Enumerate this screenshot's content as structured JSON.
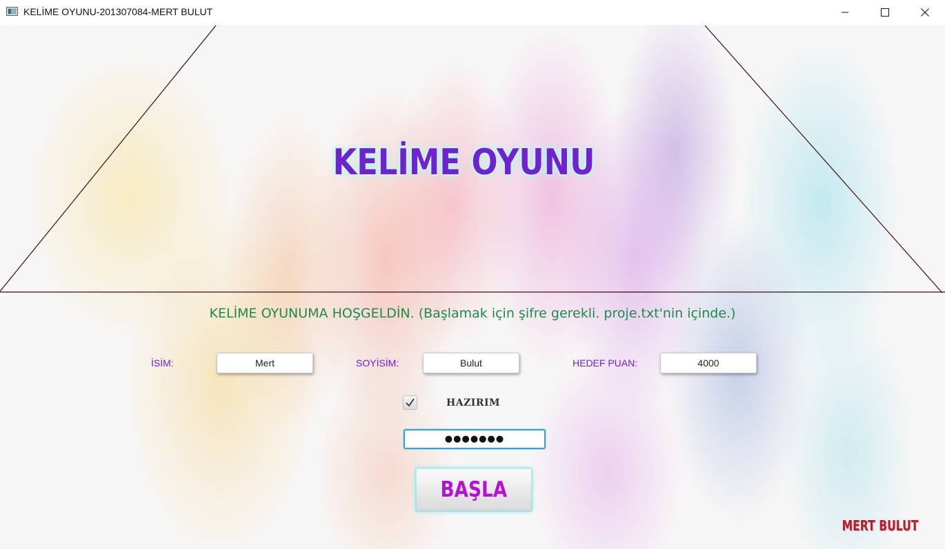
{
  "window": {
    "title": "KELİME OYUNU-201307084-MERT BULUT"
  },
  "game": {
    "title": "KELİME OYUNU",
    "welcome": "KELİME OYUNUMA HOŞGELDİN. (Başlamak için şifre gerekli. proje.txt'nin içinde.)",
    "fields": {
      "isim_label": "İSİM:",
      "isim_value": "Mert",
      "soyisim_label": "SOYİSİM:",
      "soyisim_value": "Bulut",
      "hedef_label": "HEDEF PUAN:",
      "hedef_value": "4000"
    },
    "ready_checkbox": {
      "label": "HAZIRIM",
      "checked": true
    },
    "password_mask": "●●●●●●●",
    "start_button_label": "BAŞLA",
    "signature": "MERT BULUT"
  },
  "colors": {
    "title": "#6d23cf",
    "welcome": "#1e8a4a",
    "labels": "#6a1fd6",
    "start_button_text": "#b70fd8",
    "signature": "#b3202c",
    "lines": "#3a0a12"
  },
  "icons": {
    "app": "app-window-icon",
    "minimize": "minimize-icon",
    "maximize": "maximize-icon",
    "close": "close-icon",
    "check": "checkmark-icon"
  }
}
